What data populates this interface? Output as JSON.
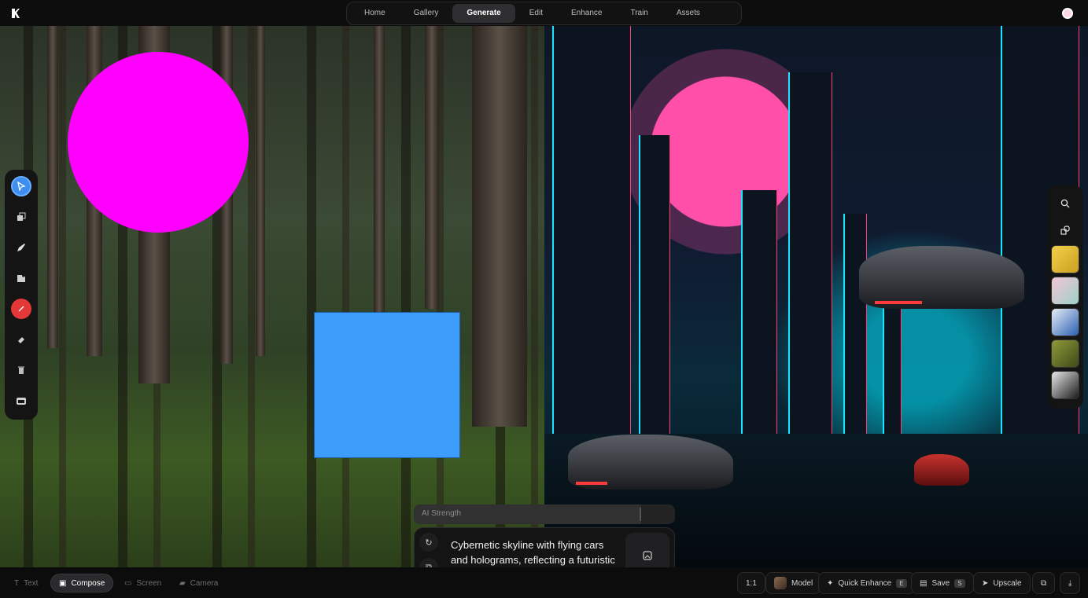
{
  "nav": {
    "items": [
      {
        "label": "Home"
      },
      {
        "label": "Gallery"
      },
      {
        "label": "Generate",
        "active": true
      },
      {
        "label": "Edit"
      },
      {
        "label": "Enhance"
      },
      {
        "label": "Train"
      },
      {
        "label": "Assets"
      }
    ]
  },
  "canvas": {
    "shapes": {
      "circle_color": "#ff00ff",
      "square_color": "#3d9dfa"
    }
  },
  "tools": [
    {
      "name": "select-tool",
      "icon": "cursor-icon"
    },
    {
      "name": "layers-tool",
      "icon": "layers-icon"
    },
    {
      "name": "pen-tool",
      "icon": "pen-icon"
    },
    {
      "name": "image-tool",
      "icon": "image-add-icon"
    },
    {
      "name": "color-tool",
      "icon": "color-picker-icon"
    },
    {
      "name": "eraser-tool",
      "icon": "eraser-icon"
    },
    {
      "name": "delete-tool",
      "icon": "trash-icon"
    },
    {
      "name": "capture-tool",
      "icon": "camera-frame-icon"
    }
  ],
  "strength": {
    "label": "AI Strength",
    "value": 0.87
  },
  "prompt": {
    "text": "Cybernetic skyline with flying cars and holograms, reflecting a futuristic anime realm."
  },
  "bottom": {
    "modes": [
      {
        "label": "Text",
        "icon": "text-icon"
      },
      {
        "label": "Compose",
        "icon": "compose-icon",
        "active": true
      },
      {
        "label": "Screen",
        "icon": "monitor-icon"
      },
      {
        "label": "Camera",
        "icon": "camera-icon"
      }
    ],
    "ratio": "1:1",
    "model_label": "Model",
    "quick_enhance_label": "Quick Enhance",
    "quick_enhance_key": "E",
    "save_label": "Save",
    "save_key": "S",
    "upscale_label": "Upscale"
  }
}
